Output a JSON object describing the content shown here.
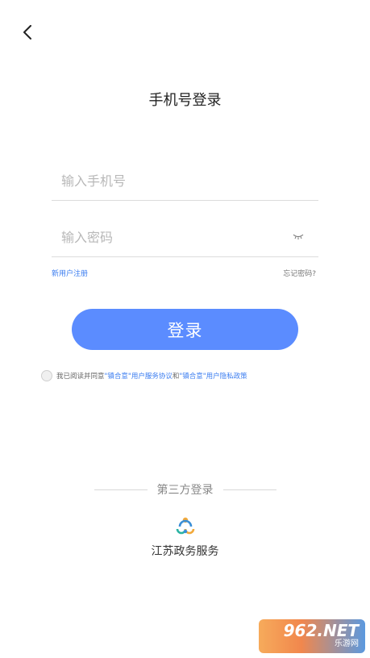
{
  "header": {
    "back_icon": "chevron-left-icon",
    "title": "手机号登录"
  },
  "form": {
    "phone_placeholder": "输入手机号",
    "phone_value": "",
    "password_placeholder": "输入密码",
    "password_value": "",
    "eye_icon": "eye-closed-icon"
  },
  "links": {
    "register": "新用户注册",
    "forgot": "忘记密码?"
  },
  "login_button": "登录",
  "agreement": {
    "prefix": "我已阅读并同意",
    "service": "\"镇合意\"用户服务协议",
    "and": "和",
    "privacy": "\"镇合意\"用户隐私政策",
    "checked": false
  },
  "third_party": {
    "title": "第三方登录",
    "providers": [
      {
        "name": "江苏政务服务",
        "icon": "jiangsu-gov-logo-icon"
      }
    ]
  },
  "watermark": {
    "top": "962.NET",
    "bottom": "乐游网"
  },
  "colors": {
    "primary": "#5b8cff",
    "link": "#3a7cf0"
  }
}
